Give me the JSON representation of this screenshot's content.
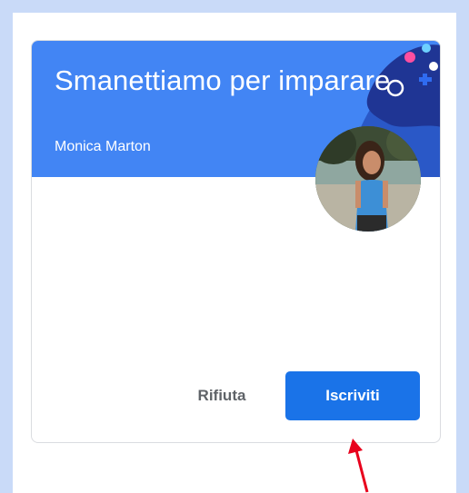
{
  "class_card": {
    "title": "Smanettiamo per imparare",
    "teacher": "Monica Marton",
    "decline_label": "Rifiuta",
    "join_label": "Iscriviti"
  },
  "colors": {
    "banner": "#4285f4",
    "join_button": "#1a73e8",
    "annotation_arrow": "#e8001c",
    "background": "#c9daf8"
  },
  "icons": [
    "gamepad-icon",
    "teacher-avatar",
    "annotation-arrow"
  ]
}
